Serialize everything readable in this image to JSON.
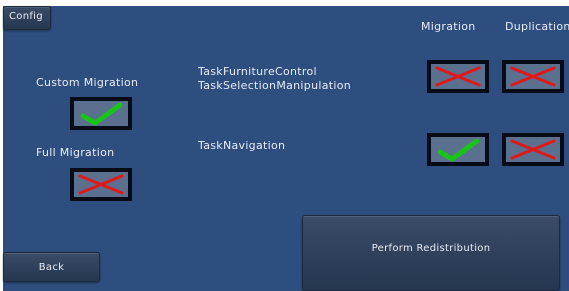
{
  "toolbar": {
    "config_label": "Config"
  },
  "column_headers": {
    "migration": "Migration",
    "duplication": "Duplication"
  },
  "modes": [
    {
      "label": "Custom Migration",
      "checked": true
    },
    {
      "label": "Full Migration",
      "checked": false
    }
  ],
  "tasks": [
    {
      "lines": [
        "TaskFurnitureControl",
        "TaskSelectionManipulation"
      ],
      "migration": false,
      "duplication": false
    },
    {
      "lines": [
        "TaskNavigation"
      ],
      "migration": true,
      "duplication": false
    }
  ],
  "actions": {
    "back_label": "Back",
    "perform_label": "Perform Redistribution"
  },
  "icons": {
    "checked": "green-checkmark-icon",
    "unchecked": "red-cross-icon"
  },
  "colors": {
    "background": "#2e4e7f",
    "text": "#e6ecf5",
    "check_green": "#19c419",
    "cross_red": "#e01818",
    "checkbox_fill": "#5b6f8e",
    "checkbox_border": "#060b15"
  }
}
